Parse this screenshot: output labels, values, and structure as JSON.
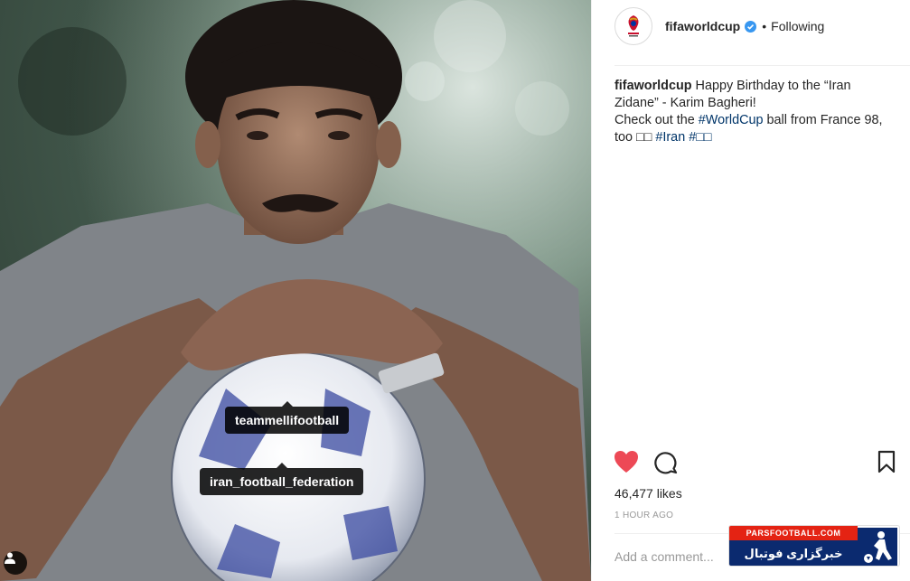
{
  "photo": {
    "tags": [
      {
        "label": "teammellifootball"
      },
      {
        "label": "iran_football_federation"
      }
    ],
    "user_tag_icon": "person-icon"
  },
  "header": {
    "username": "fifaworldcup",
    "verified_icon": "verified-badge-icon",
    "separator": "•",
    "follow_status": "Following"
  },
  "caption": {
    "username": "fifaworldcup",
    "line1_text": " Happy Birthday to the “Iran Zidane” - Karim Bagheri!",
    "line2_text": "Check out the ",
    "hashtag_worldcup": "#WorldCup",
    "line2_rest": " ball from France 98, too □□ ",
    "hashtag_iran": "#Iran",
    "space": " ",
    "hashtag_emoji": "#□□"
  },
  "actions": {
    "like_icon": "heart-filled-icon",
    "comment_icon": "comment-icon",
    "save_icon": "bookmark-icon",
    "like_color": "#ed4956"
  },
  "likes": "46,477 likes",
  "time_ago": "1 HOUR AGO",
  "comment_placeholder": "Add a comment...",
  "watermark": {
    "site": "PARSFOOTBALL.COM",
    "tagline": "خبرگزاری فوتبال ایران"
  },
  "colors": {
    "hashtag": "#003569",
    "verified": "#3897f0",
    "muted": "#999999",
    "text": "#262626"
  }
}
